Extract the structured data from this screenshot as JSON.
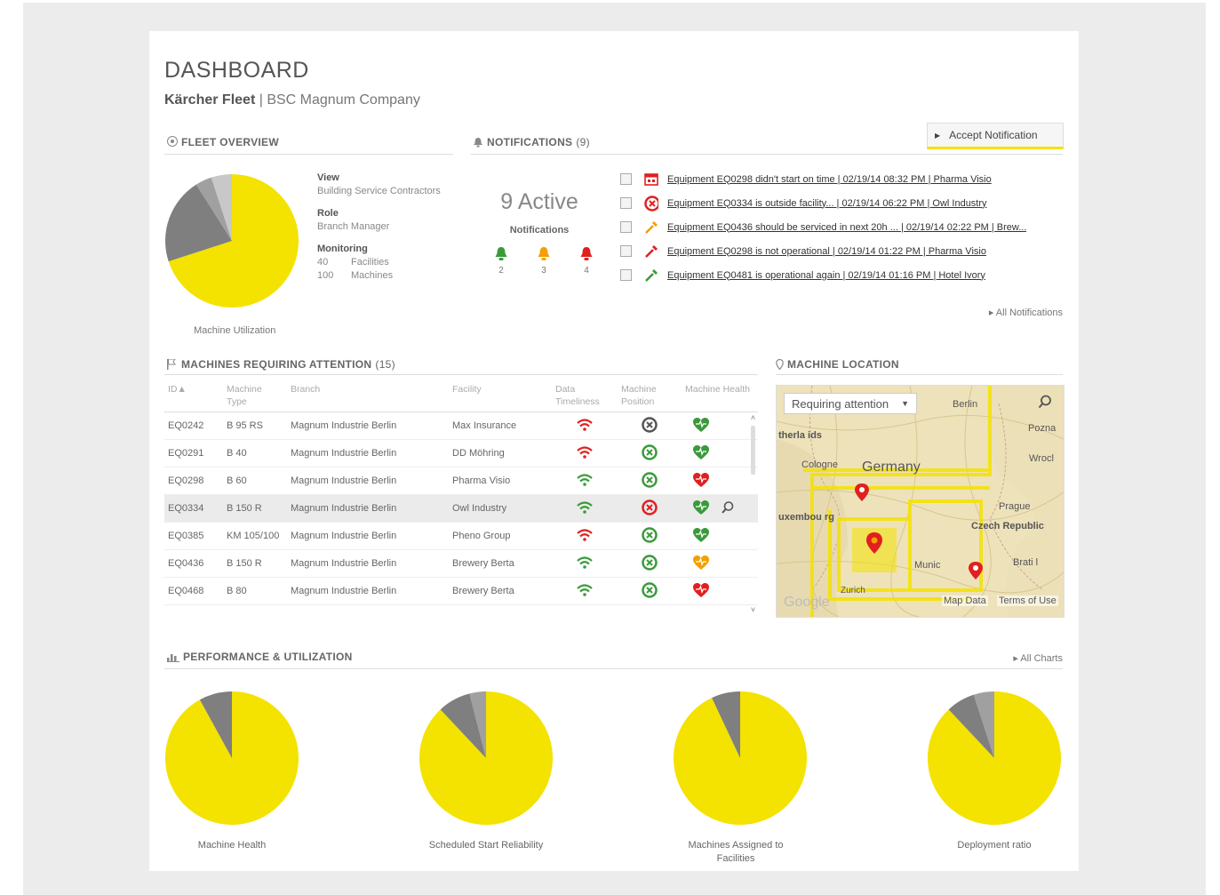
{
  "header": {
    "title": "DASHBOARD",
    "company": "Kärcher Fleet",
    "separator": "|",
    "subcompany": "BSC Magnum Company"
  },
  "fleet_overview": {
    "heading": "FLEET OVERVIEW",
    "view_label": "View",
    "view_value": "Building Service Contractors",
    "role_label": "Role",
    "role_value": "Branch Manager",
    "monitoring_label": "Monitoring",
    "facilities_count": "40",
    "facilities_label": "Facilities",
    "machines_count": "100",
    "machines_label": "Machines",
    "chart_caption": "Machine Utilization"
  },
  "notifications": {
    "heading": "NOTIFICATIONS",
    "count": "(9)",
    "active_text": "9 Active",
    "sub_label": "Notifications",
    "bells": [
      {
        "color": "#3a9a3a",
        "count": "2"
      },
      {
        "color": "#f4a000",
        "count": "3"
      },
      {
        "color": "#e02020",
        "count": "4"
      }
    ],
    "accept_button": "Accept Notification",
    "all_link": "All Notifications",
    "items": [
      {
        "icon": "calendar-icon",
        "color": "#e02020",
        "text": "Equipment EQ0298 didn't start on time | 02/19/14 08:32 PM | Pharma Visio"
      },
      {
        "icon": "no-entry-icon",
        "color": "#e02020",
        "text": "Equipment EQ0334 is outside facility... | 02/19/14 06:22 PM | Owl Industry"
      },
      {
        "icon": "wrench-icon",
        "color": "#f4a000",
        "text": "Equipment EQ0436 should be serviced in next 20h ... | 02/19/14 02:22 PM | Brew..."
      },
      {
        "icon": "wrench-icon",
        "color": "#e02020",
        "text": "Equipment EQ0298 is not operational | 02/19/14 01:22 PM | Pharma Visio"
      },
      {
        "icon": "wrench-icon",
        "color": "#3a9a3a",
        "text": "Equipment EQ0481 is operational again | 02/19/14 01:16 PM | Hotel Ivory"
      }
    ]
  },
  "machines": {
    "heading": "MACHINES REQUIRING ATTENTION",
    "count": "(15)",
    "columns": [
      "ID▲",
      "Machine Type",
      "Branch",
      "Facility",
      "Data Timeliness",
      "Machine Position",
      "Machine Health"
    ],
    "rows": [
      {
        "id": "EQ0242",
        "type": "B 95 RS",
        "branch": "Magnum Industrie Berlin",
        "facility": "Max Insurance",
        "timeliness": "#e02020",
        "position": "#555555",
        "health": "#3a9a3a"
      },
      {
        "id": "EQ0291",
        "type": "B 40",
        "branch": "Magnum Industrie Berlin",
        "facility": "DD Möhring",
        "timeliness": "#e02020",
        "position": "#3a9a3a",
        "health": "#3a9a3a"
      },
      {
        "id": "EQ0298",
        "type": "B 60",
        "branch": "Magnum Industrie Berlin",
        "facility": "Pharma Visio",
        "timeliness": "#3a9a3a",
        "position": "#3a9a3a",
        "health": "#e02020"
      },
      {
        "id": "EQ0334",
        "type": "B 150 R",
        "branch": "Magnum Industrie Berlin",
        "facility": "Owl Industry",
        "timeliness": "#3a9a3a",
        "position": "#e02020",
        "health": "#3a9a3a"
      },
      {
        "id": "EQ0385",
        "type": "KM 105/100",
        "branch": "Magnum Industrie Berlin",
        "facility": "Pheno Group",
        "timeliness": "#e02020",
        "position": "#3a9a3a",
        "health": "#3a9a3a"
      },
      {
        "id": "EQ0436",
        "type": "B 150 R",
        "branch": "Magnum Industrie Berlin",
        "facility": "Brewery Berta",
        "timeliness": "#3a9a3a",
        "position": "#3a9a3a",
        "health": "#f4a000"
      },
      {
        "id": "EQ0468",
        "type": "B 80",
        "branch": "Magnum Industrie Berlin",
        "facility": "Brewery Berta",
        "timeliness": "#3a9a3a",
        "position": "#3a9a3a",
        "health": "#e02020"
      }
    ]
  },
  "map": {
    "heading": "MACHINE LOCATION",
    "dropdown_value": "Requiring attention",
    "labels": {
      "berlin": "Berlin",
      "poznan": "Pozna",
      "netherlands": "therla ids",
      "cologne": "Cologne",
      "germany": "Germany",
      "wroclaw": "Wrocl",
      "luxembourg": "uxembou rg",
      "prague": "Prague",
      "czech": "Czech Republic",
      "munich": "Munic",
      "bratislava": "Brati l",
      "zurich": "Zurich"
    },
    "map_data": "Map Data",
    "terms": "Terms of Use",
    "google": "Google"
  },
  "performance": {
    "heading": "PERFORMANCE & UTILIZATION",
    "all_link": "All Charts",
    "charts": [
      {
        "caption": "Machine Health"
      },
      {
        "caption": "Scheduled Start Reliability"
      },
      {
        "caption": "Machines Assigned to Facilities"
      },
      {
        "caption": "Deployment ratio"
      }
    ]
  },
  "chart_data": [
    {
      "type": "pie",
      "title": "Machine Utilization",
      "colors": [
        "#f4e200",
        "#7f7f7f",
        "#a0a0a0",
        "#c8c8c8"
      ],
      "values": [
        0.7,
        0.21,
        0.04,
        0.05
      ]
    },
    {
      "type": "pie",
      "title": "Machine Health",
      "colors": [
        "#f4e200",
        "#7f7f7f"
      ],
      "values": [
        0.92,
        0.08
      ]
    },
    {
      "type": "pie",
      "title": "Scheduled Start Reliability",
      "colors": [
        "#f4e200",
        "#7f7f7f",
        "#a0a0a0"
      ],
      "values": [
        0.88,
        0.08,
        0.04
      ]
    },
    {
      "type": "pie",
      "title": "Machines Assigned to Facilities",
      "colors": [
        "#f4e200",
        "#7f7f7f"
      ],
      "values": [
        0.93,
        0.07
      ]
    },
    {
      "type": "pie",
      "title": "Deployment ratio",
      "colors": [
        "#f4e200",
        "#7f7f7f",
        "#a0a0a0"
      ],
      "values": [
        0.88,
        0.07,
        0.05
      ]
    }
  ]
}
